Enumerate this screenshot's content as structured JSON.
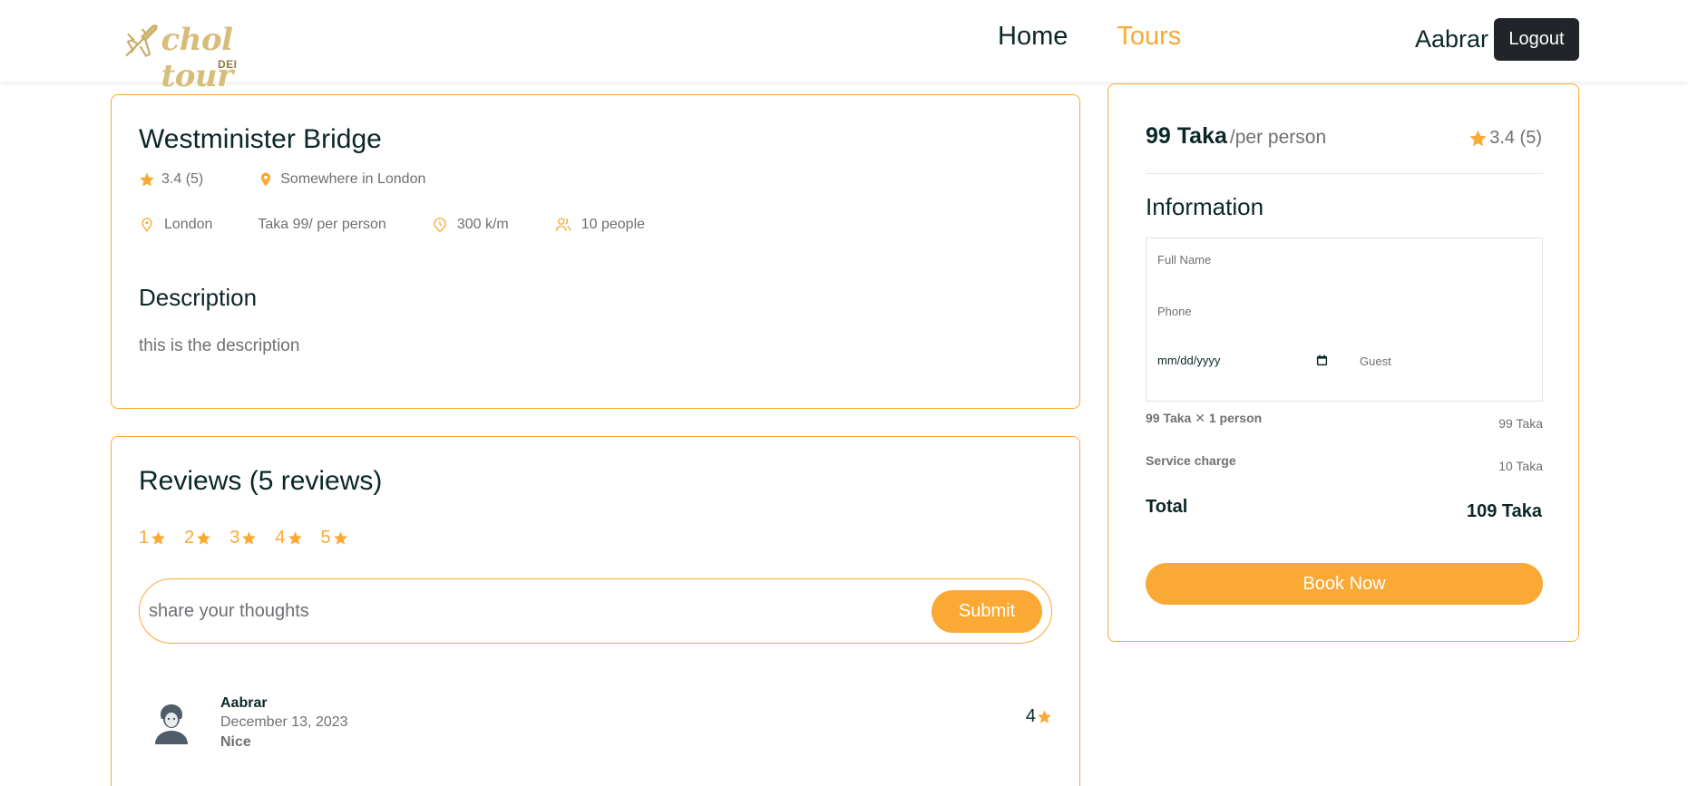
{
  "header": {
    "logo_text": "chol tour",
    "logo_sub": "DEI",
    "nav": [
      {
        "label": "Home",
        "active": false
      },
      {
        "label": "Tours",
        "active": true
      }
    ],
    "user_name": "Aabrar",
    "logout_label": "Logout"
  },
  "tour": {
    "title": "Westminister Bridge",
    "rating": "3.4 (5)",
    "address": "Somewhere in London",
    "city": "London",
    "price_text": "Taka 99/ per person",
    "distance": "300 k/m",
    "max_group": "10 people",
    "description_title": "Description",
    "description": "this is the description"
  },
  "reviews": {
    "title": "Reviews (5 reviews)",
    "rating_options": [
      "1",
      "2",
      "3",
      "4",
      "5"
    ],
    "placeholder": "share your thoughts",
    "submit_label": "Submit",
    "items": [
      {
        "name": "Aabrar",
        "date": "December 13, 2023",
        "text": "Nice",
        "rating": "4"
      }
    ]
  },
  "booking": {
    "price": "99 Taka",
    "per": "/per person",
    "rating": "3.4 (5)",
    "info_title": "Information",
    "full_name_placeholder": "Full Name",
    "phone_placeholder": "Phone",
    "date_placeholder": "mm/dd/yyyy",
    "guest_placeholder": "Guest",
    "line1_label": "99 Taka  ✕  1 person",
    "line1_value": "99 Taka",
    "service_label": "Service charge",
    "service_value": "10 Taka",
    "total_label": "Total",
    "total_value": "109 Taka",
    "book_label": "Book Now"
  },
  "colors": {
    "accent": "#faa935",
    "heading": "#0b2727",
    "text": "#6e7074",
    "dark_button": "#212529"
  }
}
